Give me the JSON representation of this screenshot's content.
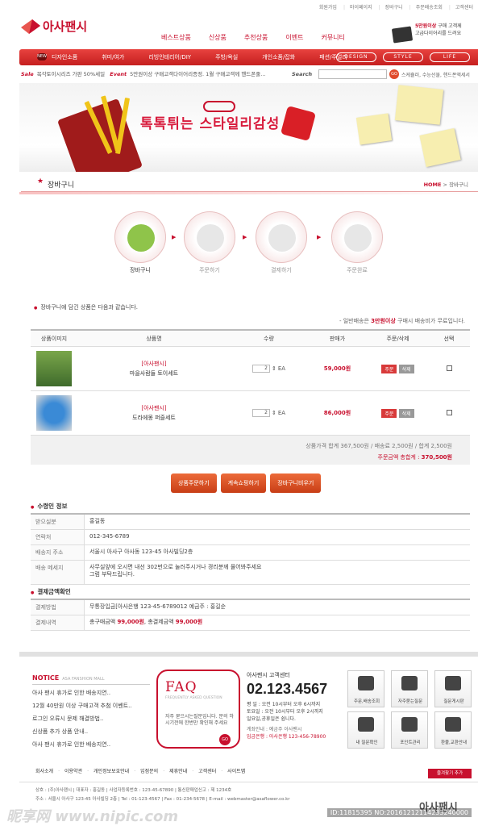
{
  "util_links": [
    "회원가입",
    "마이페이지",
    "장바구니",
    "주문배송조회",
    "고객센터"
  ],
  "logo": {
    "text": "아사팬시"
  },
  "top_nav": [
    "베스트상품",
    "신상품",
    "추천상품",
    "이벤트",
    "커뮤니티"
  ],
  "promo": {
    "amount": "5만원이상",
    "line1": "구매 고객께",
    "line2": "고급다이어리를 드려요"
  },
  "category_new_badge": "NEW",
  "categories": [
    "디자인소품",
    "취미/여가",
    "리빙인테리어/DIY",
    "주방/욕실",
    "개인소품/잡화",
    "패션/주얼리"
  ],
  "category_pills": [
    "DESIGN",
    "STYLE",
    "LIFE"
  ],
  "sale_strip": {
    "sale_label": "Sale",
    "sale_text": "목각토이시리즈 가판 50%세일",
    "event_label": "Event",
    "event_text": "5만원이상 구매고객다이어리증정. 1월 구매고객께 핸드폰줄...",
    "search_label": "Search",
    "go": "GO",
    "keywords": "스케쥴러, 수능선물, 핸드폰액세서"
  },
  "banner": {
    "headline": "톡톡튀는 스타일리감성"
  },
  "page_title": {
    "title": "장바구니",
    "crumb_home": "HOME",
    "crumb_sep": ">",
    "crumb_current": "장바구니"
  },
  "steps": [
    {
      "label": "장바구니"
    },
    {
      "label": "주문하기"
    },
    {
      "label": "결제하기"
    },
    {
      "label": "주문완료"
    }
  ],
  "cart_intro": "장바구니에 담긴 상품은 다음과 같습니다.",
  "shipping_note": {
    "prefix": "- 일반배송은 ",
    "highlight": "3만원이상",
    "suffix": " 구매시 배송비가 무료입니다."
  },
  "cart_table": {
    "headers": [
      "상품이미지",
      "상품명",
      "수량",
      "판매가",
      "주문/삭제",
      "선택"
    ],
    "rows": [
      {
        "brand": "[아사팬시]",
        "name": "마을사람들 토이세트",
        "qty": "2",
        "unit": "EA",
        "price": "59,000원",
        "order": "주문",
        "delete": "삭제"
      },
      {
        "brand": "[아사팬시]",
        "name": "도라에몽 퍼즐세트",
        "qty": "2",
        "unit": "EA",
        "price": "86,000원",
        "order": "주문",
        "delete": "삭제"
      }
    ]
  },
  "summary": {
    "line1": "상품가격 합계 367,500원  /  배송료 2,500원  /  합계 2,500원",
    "line2_label": "주문금액 총합계 : ",
    "line2_value": "370,500원"
  },
  "actions": [
    "상품주문하기",
    "계속쇼핑하기",
    "장바구니비우기"
  ],
  "receiver": {
    "title": "수령인 정보",
    "rows": [
      {
        "k": "받으실분",
        "v": "홍길동"
      },
      {
        "k": "연락처",
        "v": "012-345-6789"
      },
      {
        "k": "배송지 주소",
        "v": "서울시 아사구 아사동 123-45 아사빌딩2층"
      },
      {
        "k": "배송 메세지",
        "v": "사무실앞에 오시면 내선 302번으로 눌러주시거나 경리분께 물어봐주세요\n그럼 부탁드립니다."
      }
    ]
  },
  "payment": {
    "title": "결제금액확인",
    "method_k": "결제방법",
    "method_v": "무통장입금[아사은행 123-45-6789012  예금주 : 홍길순",
    "amount_k": "결제내역",
    "amount_a": "총구매금액 ",
    "amount_b": "99,000원",
    "amount_c": ", 총결제금액 ",
    "amount_d": "99,000원"
  },
  "notice": {
    "title": "NOTICE",
    "sub": "ASA FANSHION MALL",
    "items": [
      "아사 팬시 휴가로 인한 배송지연..",
      "12월 40만원 이상 구매고객 추첨 이벤트..",
      "로그인 오류시 문제 해결방법..",
      "신상품 추가 상품 안내..",
      "아사 팬시 휴가로 인한 배송지연.."
    ]
  },
  "faq": {
    "title": "FAQ",
    "sub": "FREQUENTLY ASKED QUESTION",
    "desc": "자주 묻으시는질문입니다. 문의 하시기전에 한번만 확인해 주세요",
    "go": "GO"
  },
  "customer_center": {
    "label": "아사팬시 고객센터",
    "phone": "02.123.4567",
    "hours1": "평  일 : 오전 10시부터 오후 6시까지",
    "hours2": "토요일 : 오전 10시부터 오후 2시까지",
    "hours3": "일요일,공휴일은 쉽니다.",
    "bank1": "계좌안내 : 예금주 아사팬시",
    "bank2": "입금은행 : 아사은행 123-456-78900"
  },
  "quick_icons": [
    "주문,배송조회",
    "자주묻는질문",
    "질문게시판",
    "내 질문확인",
    "포인트관리",
    "환불,교환안내"
  ],
  "footer_nav": [
    "회사소개",
    "이용약관",
    "개인정보보호안내",
    "입점문의",
    "제휴안내",
    "고객센터",
    "사이트맵"
  ],
  "favorite": "즐겨찾기 추가",
  "footer_info": {
    "line1": "상호 : (주)아사팬시  |  대표자 : 홍길동  |  사업자등록번호 : 123-45-67890  |  통신판매업신고 : 제 1234호",
    "line2": "주소 : 서울시 아사구 123-45 아사빌딩 2층  |  Tel : 01-123-4567  |  Fax : 01-234-5678  |  E-mail : webmaster@asaflower.co.kr",
    "logo": "아사팬시"
  },
  "watermark": {
    "text": "昵享网 www.nipic.com",
    "id": "ID:11815395 NO:20161212114233240000"
  }
}
